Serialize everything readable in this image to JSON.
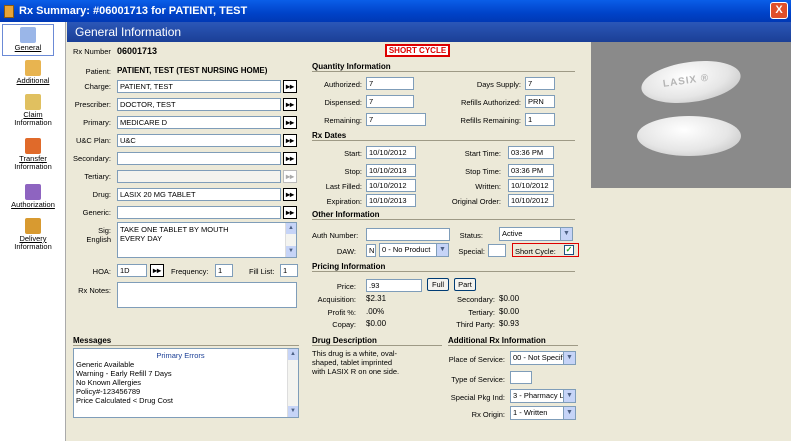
{
  "window": {
    "title": "Rx Summary: #06001713 for PATIENT, TEST",
    "close_label": "X"
  },
  "sidebar": {
    "items": [
      {
        "label1": "General",
        "label2": ""
      },
      {
        "label1": "Additional",
        "label2": ""
      },
      {
        "label1": "Claim",
        "label2": "Information"
      },
      {
        "label1": "Transfer",
        "label2": "Information"
      },
      {
        "label1": "Authorization",
        "label2": ""
      },
      {
        "label1": "Delivery",
        "label2": "Information"
      }
    ]
  },
  "header": {
    "title": "General Information"
  },
  "rx": {
    "number_label": "Rx Number",
    "number": "06001713",
    "short_cycle_banner": "SHORT CYCLE",
    "patient_label": "Patient:",
    "patient": "PATIENT, TEST (TEST NURSING HOME)",
    "charge_label": "Charge:",
    "charge": "PATIENT, TEST",
    "prescriber_label": "Prescriber:",
    "prescriber": "DOCTOR, TEST",
    "primary_label": "Primary:",
    "primary": "MEDICARE D",
    "ucplan_label": "U&C Plan:",
    "ucplan": "U&C",
    "secondary_label": "Secondary:",
    "secondary": "",
    "tertiary_label": "Tertiary:",
    "tertiary": "",
    "drug_label": "Drug:",
    "drug": "LASIX 20 MG TABLET",
    "generic_label": "Generic:",
    "generic": "",
    "sig_label": "Sig:",
    "english_label": "English",
    "sig_line1": "TAKE ONE TABLET BY MOUTH",
    "sig_line2": "EVERY DAY",
    "hoa_label": "HOA:",
    "hoa": "1D",
    "frequency_label": "Frequency:",
    "frequency": "1",
    "filllist_label": "Fill List:",
    "filllist": "1",
    "notes_label": "Rx Notes:"
  },
  "quantity": {
    "section": "Quantity Information",
    "authorized_label": "Authorized:",
    "authorized": "7",
    "dispensed_label": "Dispensed:",
    "dispensed": "7",
    "remaining_label": "Remaining:",
    "remaining": "7",
    "days_supply_label": "Days Supply:",
    "days_supply": "7",
    "refills_auth_label": "Refills Authorized:",
    "refills_auth": "PRN",
    "refills_rem_label": "Refills Remaining:",
    "refills_rem": "1"
  },
  "dates": {
    "section": "Rx Dates",
    "start_label": "Start:",
    "start": "10/10/2012",
    "stop_label": "Stop:",
    "stop": "10/10/2013",
    "lastfilled_label": "Last Filled:",
    "lastfilled": "10/10/2012",
    "expiration_label": "Expiration:",
    "expiration": "10/10/2013",
    "starttime_label": "Start Time:",
    "starttime": "03:36 PM",
    "stoptime_label": "Stop Time:",
    "stoptime": "03:36 PM",
    "written_label": "Written:",
    "written": "10/10/2012",
    "origorder_label": "Original Order:",
    "origorder": "10/10/2012"
  },
  "other": {
    "section": "Other Information",
    "auth_label": "Auth Number:",
    "auth": "",
    "daw_label": "DAW:",
    "daw_flag": "N",
    "daw": "0 - No Product",
    "status_label": "Status:",
    "status": "Active",
    "special_label": "Special:",
    "short_cycle_label": "Short Cycle:",
    "short_cycle_check": "✓"
  },
  "pricing": {
    "section": "Pricing Information",
    "price_label": "Price:",
    "price": ".93",
    "full_btn": "Full",
    "part_btn": "Part",
    "acquisition_label": "Acquisition:",
    "acquisition": "$2.31",
    "profit_label": "Profit %:",
    "profit": ".00%",
    "copay_label": "Copay:",
    "copay": "$0.00",
    "secondary_label": "Secondary:",
    "secondary": "$0.00",
    "tertiary_label": "Tertiary:",
    "tertiary": "$0.00",
    "thirdparty_label": "Third Party:",
    "thirdparty": "$0.93"
  },
  "messages": {
    "section": "Messages",
    "header": "Primary Errors",
    "lines": [
      "Generic Available",
      "Warning - Early Refill 7 Days",
      "No Known Allergies",
      "Policy#-123456789",
      "Price Calculated < Drug Cost"
    ]
  },
  "drug_desc": {
    "section": "Drug Description",
    "line1": "This drug is a white, oval-",
    "line2": "shaped, tablet imprinted",
    "line3": "with LASIX R on one side."
  },
  "additional": {
    "section": "Additional Rx Information",
    "pos_label": "Place of Service:",
    "pos": "00 - Not Specif",
    "tos_label": "Type of Service:",
    "tos": "",
    "spi_label": "Special Pkg Ind:",
    "spi": "3 - Pharmacy L",
    "origin_label": "Rx Origin:",
    "origin": "1 - Written"
  },
  "pill_image": {
    "imprint": "LASIX ®"
  },
  "colors": {
    "accent": "#0A5EE8",
    "header": "#2B57B8",
    "alert": "#DD0000"
  }
}
